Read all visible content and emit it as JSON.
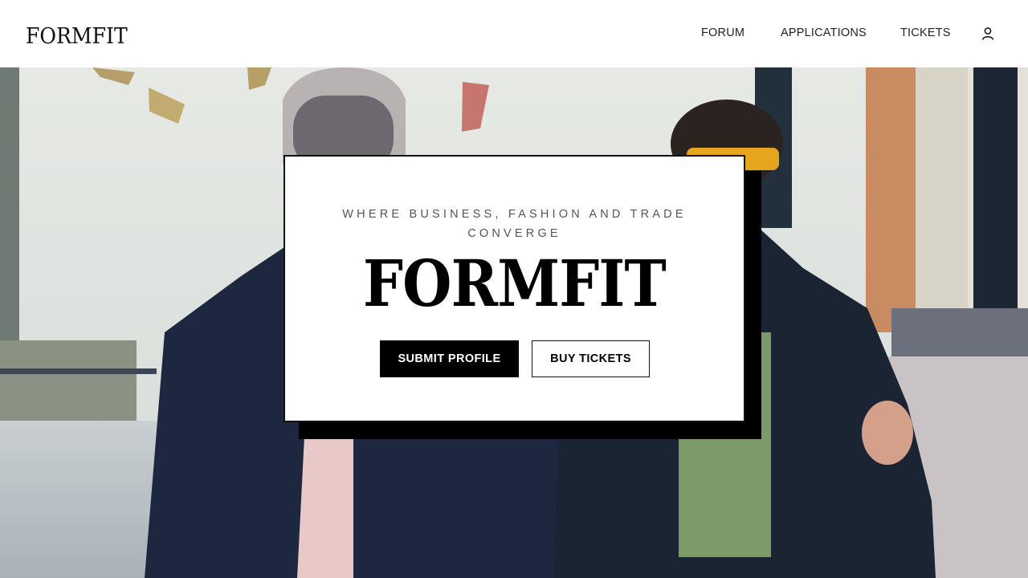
{
  "header": {
    "logo": "FORMFIT",
    "nav": [
      {
        "label": "FORUM"
      },
      {
        "label": "APPLICATIONS"
      },
      {
        "label": "TICKETS"
      }
    ],
    "account_icon": "user-icon"
  },
  "hero": {
    "background": "street-fashion-photo"
  },
  "card": {
    "tagline": "WHERE BUSINESS, FASHION AND TRADE CONVERGE",
    "title": "FORMFIT",
    "primary_button": "SUBMIT PROFILE",
    "secondary_button": "BUY TICKETS"
  },
  "colors": {
    "accent": "#000000",
    "background": "#ffffff"
  }
}
